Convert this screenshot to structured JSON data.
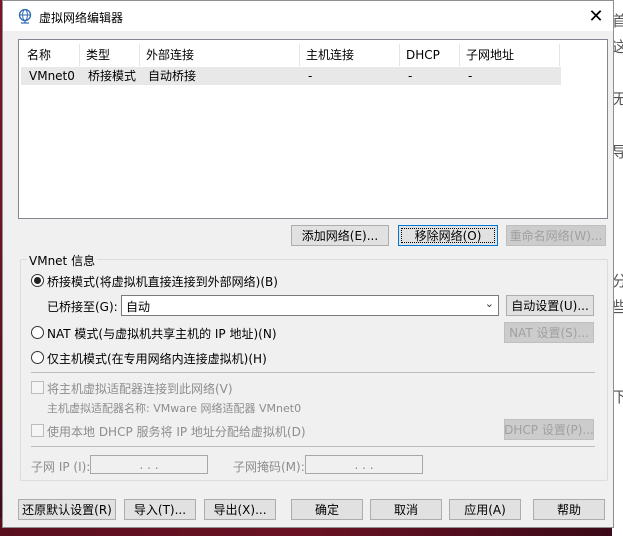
{
  "window": {
    "title": "虚拟网络编辑器",
    "close_label": "✕"
  },
  "network_table": {
    "columns": [
      "名称",
      "类型",
      "外部连接",
      "主机连接",
      "DHCP",
      "子网地址"
    ],
    "rows": [
      {
        "name": "VMnet0",
        "type": "桥接模式",
        "external": "自动桥接",
        "host": "-",
        "dhcp": "-",
        "subnet": "-"
      }
    ]
  },
  "list_buttons": {
    "add": "添加网络(E)...",
    "remove": "移除网络(O)",
    "rename": "重命名网络(W)..."
  },
  "vmnet_info": {
    "group_label": "VMnet 信息",
    "bridged_label": "桥接模式(将虚拟机直接连接到外部网络)(B)",
    "bridged_to_label": "已桥接至(G):",
    "bridged_to_value": "自动",
    "auto_settings": "自动设置(U)...",
    "nat_label": "NAT 模式(与虚拟机共享主机的 IP 地址)(N)",
    "nat_settings": "NAT 设置(S)...",
    "host_only_label": "仅主机模式(在专用网络内连接虚拟机)(H)",
    "connect_adapter_label": "将主机虚拟适配器连接到此网络(V)",
    "adapter_name_label": "主机虚拟适配器名称: VMware 网络适配器 VMnet0",
    "dhcp_label": "使用本地 DHCP 服务将 IP 地址分配给虚拟机(D)",
    "dhcp_settings": "DHCP 设置(P)...",
    "subnet_ip_label": "子网 IP (I):",
    "subnet_mask_label": "子网掩码(M):",
    "ip_placeholder": ".   .   ."
  },
  "footer_buttons": {
    "restore": "还原默认设置(R)",
    "import": "导入(T)...",
    "export": "导出(X)...",
    "ok": "确定",
    "cancel": "取消",
    "apply": "应用(A)",
    "help": "帮助"
  },
  "selection": {
    "mode": "bridged"
  },
  "background_glyphs": [
    "首",
    "这",
    "无",
    "导",
    "分",
    "些",
    "下"
  ]
}
